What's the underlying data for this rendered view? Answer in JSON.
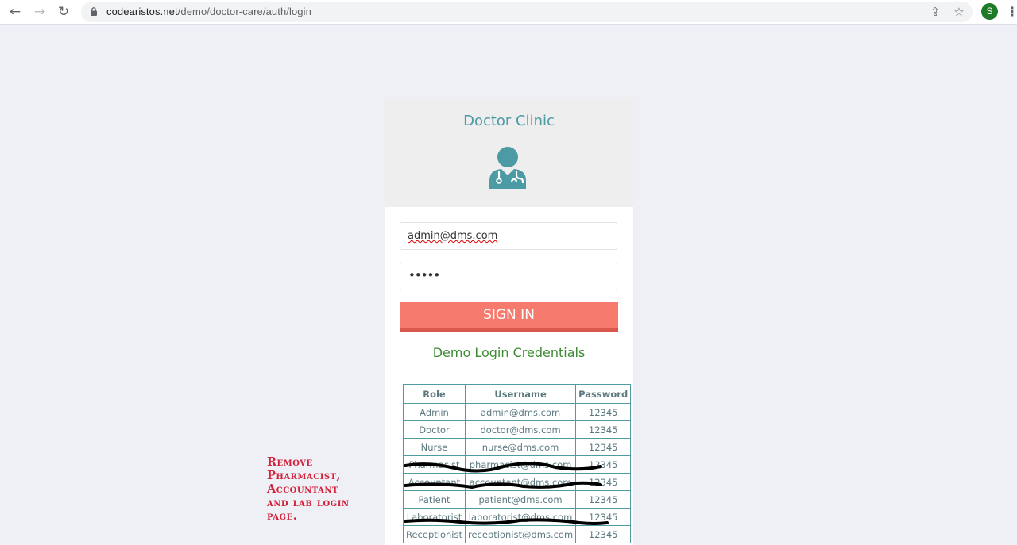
{
  "browser": {
    "url_host": "codearistos.net",
    "url_path": "/demo/doctor-care/auth/login",
    "profile_initial": "S",
    "nav_icons": [
      "back-icon",
      "forward-icon",
      "reload-icon"
    ],
    "omnibox_icons": [
      "lock-icon",
      "share-icon",
      "star-icon"
    ],
    "profile_color": "#1e7a27"
  },
  "login": {
    "title": "Doctor Clinic",
    "email_value": "admin@dms.com",
    "password_masked": "•••••",
    "submit_label": "SIGN IN",
    "demo_heading": "Demo Login Credentials",
    "accent_color": "#f67a6e",
    "title_color": "#4b9aa4"
  },
  "credentials": {
    "headers": [
      "Role",
      "Username",
      "Password"
    ],
    "rows": [
      {
        "role": "Admin",
        "username": "admin@dms.com",
        "password": "12345",
        "struck": false
      },
      {
        "role": "Doctor",
        "username": "doctor@dms.com",
        "password": "12345",
        "struck": false
      },
      {
        "role": "Nurse",
        "username": "nurse@dms.com",
        "password": "12345",
        "struck": false
      },
      {
        "role": "Pharmacist",
        "username": "pharmacist@dms.com",
        "password": "12345",
        "struck": true
      },
      {
        "role": "Accountant",
        "username": "accountant@dms.com",
        "password": "12345",
        "struck": true
      },
      {
        "role": "Patient",
        "username": "patient@dms.com",
        "password": "12345",
        "struck": false
      },
      {
        "role": "Laboratorist",
        "username": "laboratorist@dms.com",
        "password": "12345",
        "struck": true
      },
      {
        "role": "Receptionist",
        "username": "receptionist@dms.com",
        "password": "12345",
        "struck": false
      }
    ]
  },
  "annotation": {
    "lines": [
      "Remove",
      "Pharmacist,",
      "Accountant",
      "and lab login",
      "page."
    ],
    "color": "#d4213a"
  }
}
